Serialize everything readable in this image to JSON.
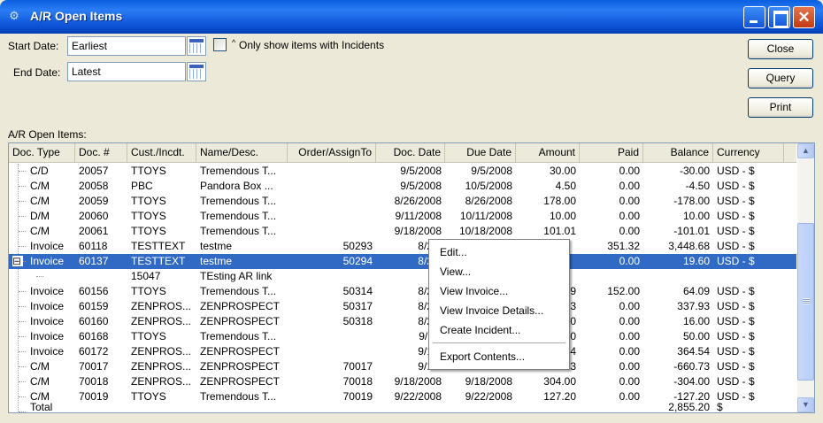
{
  "window": {
    "title": "A/R Open Items",
    "icon": "app-network-icon"
  },
  "filters": {
    "start_label": "Start Date:",
    "start_value": "Earliest",
    "end_label": "End Date:",
    "end_value": "Latest",
    "incidents_checked": false,
    "incidents_label": "Only show items with Incidents"
  },
  "buttons": {
    "close": "Close",
    "query": "Query",
    "print": "Print"
  },
  "grid": {
    "label": "A/R Open Items:",
    "columns": [
      "Doc. Type",
      "Doc. #",
      "Cust./Incdt.",
      "Name/Desc.",
      "Order/AssignTo",
      "Doc. Date",
      "Due Date",
      "Amount",
      "Paid",
      "Balance",
      "Currency"
    ],
    "rows": [
      {
        "type": "C/D",
        "doc": "20057",
        "cust": "TTOYS",
        "name": "Tremendous T...",
        "order": "",
        "docdate": "9/5/2008",
        "due": "9/5/2008",
        "amount": "30.00",
        "paid": "0.00",
        "balance": "-30.00",
        "currency": "USD - $"
      },
      {
        "type": "C/M",
        "doc": "20058",
        "cust": "PBC",
        "name": "Pandora Box ...",
        "order": "",
        "docdate": "9/5/2008",
        "due": "10/5/2008",
        "amount": "4.50",
        "paid": "0.00",
        "balance": "-4.50",
        "currency": "USD - $"
      },
      {
        "type": "C/M",
        "doc": "20059",
        "cust": "TTOYS",
        "name": "Tremendous T...",
        "order": "",
        "docdate": "8/26/2008",
        "due": "8/26/2008",
        "amount": "178.00",
        "paid": "0.00",
        "balance": "-178.00",
        "currency": "USD - $"
      },
      {
        "type": "D/M",
        "doc": "20060",
        "cust": "TTOYS",
        "name": "Tremendous T...",
        "order": "",
        "docdate": "9/11/2008",
        "due": "10/11/2008",
        "amount": "10.00",
        "paid": "0.00",
        "balance": "10.00",
        "currency": "USD - $"
      },
      {
        "type": "C/M",
        "doc": "20061",
        "cust": "TTOYS",
        "name": "Tremendous T...",
        "order": "",
        "docdate": "9/18/2008",
        "due": "10/18/2008",
        "amount": "101.01",
        "paid": "0.00",
        "balance": "-101.01",
        "currency": "USD - $"
      },
      {
        "type": "Invoice",
        "doc": "60118",
        "cust": "TESTTEXT",
        "name": "testme",
        "order": "50293",
        "docdate": "8/20/",
        "due": "",
        "amount": "",
        "paid": "351.32",
        "balance": "3,448.68",
        "currency": "USD - $"
      },
      {
        "type": "Invoice",
        "doc": "60137",
        "cust": "TESTTEXT",
        "name": "testme",
        "order": "50294",
        "docdate": "8/20/",
        "due": "",
        "amount": "",
        "paid": "0.00",
        "balance": "19.60",
        "currency": "USD - $",
        "selected": true,
        "expander": "⊟"
      },
      {
        "type": "",
        "doc": "",
        "cust": "15047",
        "name": "TEsting AR link",
        "order": "",
        "docdate": "",
        "due": "",
        "amount": "",
        "paid": "",
        "balance": "",
        "currency": "",
        "child": true
      },
      {
        "type": "Invoice",
        "doc": "60156",
        "cust": "TTOYS",
        "name": "Tremendous T...",
        "order": "50314",
        "docdate": "8/28/",
        "due": "",
        "amount": "9",
        "paid": "152.00",
        "balance": "64.09",
        "currency": "USD - $"
      },
      {
        "type": "Invoice",
        "doc": "60159",
        "cust": "ZENPROS...",
        "name": "ZENPROSPECT",
        "order": "50317",
        "docdate": "8/28/",
        "due": "",
        "amount": "3",
        "paid": "0.00",
        "balance": "337.93",
        "currency": "USD - $"
      },
      {
        "type": "Invoice",
        "doc": "60160",
        "cust": "ZENPROS...",
        "name": "ZENPROSPECT",
        "order": "50318",
        "docdate": "8/28/",
        "due": "",
        "amount": "0",
        "paid": "0.00",
        "balance": "16.00",
        "currency": "USD - $"
      },
      {
        "type": "Invoice",
        "doc": "60168",
        "cust": "TTOYS",
        "name": "Tremendous T...",
        "order": "",
        "docdate": "9/11/",
        "due": "",
        "amount": "0",
        "paid": "0.00",
        "balance": "50.00",
        "currency": "USD - $"
      },
      {
        "type": "Invoice",
        "doc": "60172",
        "cust": "ZENPROS...",
        "name": "ZENPROSPECT",
        "order": "",
        "docdate": "9/18/",
        "due": "",
        "amount": "4",
        "paid": "0.00",
        "balance": "364.54",
        "currency": "USD - $"
      },
      {
        "type": "C/M",
        "doc": "70017",
        "cust": "ZENPROS...",
        "name": "ZENPROSPECT",
        "order": "70017",
        "docdate": "9/18/",
        "due": "",
        "amount": "3",
        "paid": "0.00",
        "balance": "-660.73",
        "currency": "USD - $"
      },
      {
        "type": "C/M",
        "doc": "70018",
        "cust": "ZENPROS...",
        "name": "ZENPROSPECT",
        "order": "70018",
        "docdate": "9/18/2008",
        "due": "9/18/2008",
        "amount": "304.00",
        "paid": "0.00",
        "balance": "-304.00",
        "currency": "USD - $"
      },
      {
        "type": "C/M",
        "doc": "70019",
        "cust": "TTOYS",
        "name": "Tremendous T...",
        "order": "70019",
        "docdate": "9/22/2008",
        "due": "9/22/2008",
        "amount": "127.20",
        "paid": "0.00",
        "balance": "-127.20",
        "currency": "USD - $"
      },
      {
        "type": "Total",
        "doc": "",
        "cust": "",
        "name": "",
        "order": "",
        "docdate": "",
        "due": "",
        "amount": "",
        "paid": "",
        "balance": "2,855.20",
        "currency": "$",
        "clipped": true
      }
    ]
  },
  "context_menu": {
    "items": [
      "Edit...",
      "View...",
      "View Invoice...",
      "View Invoice Details...",
      "Create Incident..."
    ],
    "export": "Export Contents..."
  },
  "colors": {
    "selection": "#316ac5",
    "titlebar": "#0a5fe0"
  }
}
